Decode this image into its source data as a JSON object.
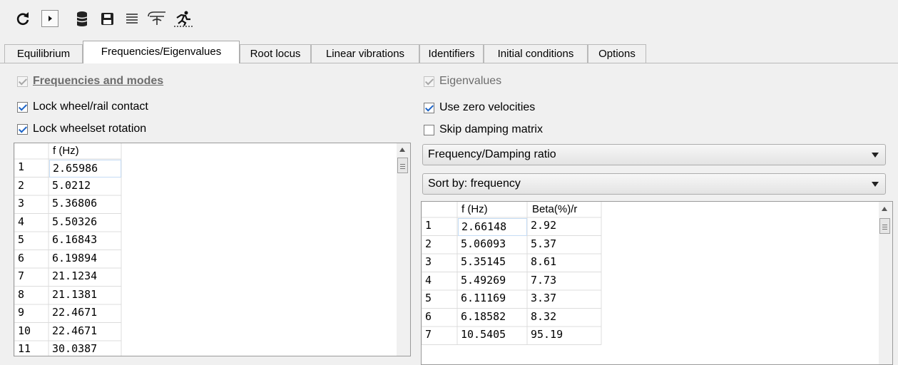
{
  "toolbar": {
    "icons": [
      "refresh-icon",
      "play-icon",
      "database-icon",
      "save-icon",
      "list-icon",
      "loop-icon",
      "runner-icon"
    ]
  },
  "tabs": [
    "Equilibrium",
    "Frequencies/Eigenvalues",
    "Root locus",
    "Linear vibrations",
    "Identifiers",
    "Initial conditions",
    "Options"
  ],
  "active_tab": "Frequencies/Eigenvalues",
  "left": {
    "header_check": "Frequencies and modes",
    "lock_contact": "Lock wheel/rail contact",
    "lock_rotation": "Lock wheelset rotation",
    "table": {
      "col": "f (Hz)",
      "rows": [
        [
          "1",
          "2.65986"
        ],
        [
          "2",
          "5.0212"
        ],
        [
          "3",
          "5.36806"
        ],
        [
          "4",
          "5.50326"
        ],
        [
          "5",
          "6.16843"
        ],
        [
          "6",
          "6.19894"
        ],
        [
          "7",
          "21.1234"
        ],
        [
          "8",
          "21.1381"
        ],
        [
          "9",
          "22.4671"
        ],
        [
          "10",
          "22.4671"
        ],
        [
          "11",
          "30.0387"
        ]
      ]
    }
  },
  "right": {
    "eigenvalues": "Eigenvalues",
    "zero_vel": "Use zero velocities",
    "skip_damping": "Skip damping matrix",
    "combo1": "Frequency/Damping ratio",
    "combo2": "Sort by: frequency",
    "table": {
      "col1": "f (Hz)",
      "col2": "Beta(%)/r",
      "rows": [
        [
          "1",
          "2.66148",
          "2.92"
        ],
        [
          "2",
          "5.06093",
          "5.37"
        ],
        [
          "3",
          "5.35145",
          "8.61"
        ],
        [
          "4",
          "5.49269",
          "7.73"
        ],
        [
          "5",
          "6.11169",
          "3.37"
        ],
        [
          "6",
          "6.18582",
          "8.32"
        ],
        [
          "7",
          "10.5405",
          "95.19"
        ]
      ]
    }
  },
  "colors": {
    "accent": "#1a62c6",
    "border": "#9a9a9a",
    "selected_cell": "#c5dcf5"
  }
}
